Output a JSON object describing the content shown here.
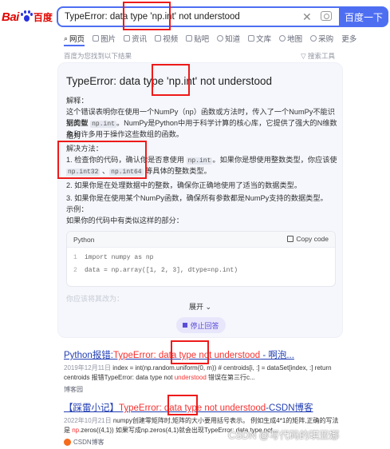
{
  "header": {
    "logo_text": "Bai",
    "logo_text2": "百度",
    "search_value": "TypeError: data type 'np.int' not understood",
    "clear_icon": "close-icon",
    "camera_icon": "camera-icon",
    "search_button": "百度一下"
  },
  "tabs": [
    {
      "label": "网页",
      "icon": "search-icon"
    },
    {
      "label": "图片",
      "icon": "image-icon"
    },
    {
      "label": "资讯",
      "icon": "news-icon"
    },
    {
      "label": "视频",
      "icon": "video-icon"
    },
    {
      "label": "贴吧",
      "icon": "tieba-icon"
    },
    {
      "label": "知道",
      "icon": "zhidao-icon"
    },
    {
      "label": "文库",
      "icon": "doc-icon"
    },
    {
      "label": "地图",
      "icon": "map-icon"
    },
    {
      "label": "采购",
      "icon": "cart-icon"
    },
    {
      "label": "更多",
      "icon": ""
    }
  ],
  "info_bar": {
    "left": "百度为您找到以下结果",
    "right": "搜索工具"
  },
  "ai_answer": {
    "title": "TypeError: data type 'np.int' not understood",
    "explain_head": "解释：",
    "explain_1a": "这个错误表明你在使用一个NumPy（np）函数或方法时，传入了一个NumPy不能识别的数",
    "explain_2a": "据类型 ",
    "explain_2_code": "np.int",
    "explain_2b": "。NumPy是Python中用于科学计算的核心库，它提供了强大的N维数组对",
    "explain_3": "象和许多用于操作这些数组的函数。",
    "solution_head": "解决方法：",
    "step1a": "1.  检查你的代码，确认你是否意使用 ",
    "step1_code": "np.int",
    "step1b": "。如果你是想使用整数类型，你应该使用",
    "step1c_code": "np.int32",
    "step1d": " 、",
    "step1e_code": "np.int64",
    "step1f": " 等具体的整数类型。",
    "step2": "2.  如果你是在处理数据中的整数，确保你正确地使用了适当的数据类型。",
    "step3": "3.  如果你是在使用某个NumPy函数，确保所有参数都是NumPy支持的数据类型。",
    "example_head": "示例：",
    "example_line": "如果你的代码中有类似这样的部分：",
    "code_lang": "Python",
    "copy_label": "Copy code",
    "code_line1": "import numpy as np",
    "code_line2": "data = np.array([1, 2, 3], dtype=np.int)",
    "fade_text": "你应该将其改为：",
    "expand_label": "展开",
    "stop_label": "停止回答"
  },
  "results": [
    {
      "title_a": "Python报错:",
      "title_b": "TypeError: data type not understood",
      "title_c": " - 啊泡...",
      "desc_date": "2019年12月11日",
      "desc_a": " index = int(np.random.uniform(0, m)) # centroids[i, :] = dataSet[index, :] return centroids 报错TypeError: data type not ",
      "desc_em": "understood",
      "desc_b": " 错误在第三行c...",
      "source": "博客园"
    },
    {
      "title_a": "【踩雷小记】",
      "title_b": "TypeError: data type not understood",
      "title_c": "-CSDN博客",
      "desc_date": "2022年10月21日",
      "desc_a": " numpy创建零矩阵时,矩阵的大小要用括号表示。 例如生成4*1的矩阵,正确的写法是 ",
      "desc_em": "np",
      "desc_b": ".zeros((4,1)) 如果写成np.zeros(4,1)就会出现TypeError: data type not...",
      "source": "CSDN博客"
    }
  ],
  "watermark": "CSDN @写代码的琪亚娜",
  "colors": {
    "brand_blue": "#4e6ef2",
    "link_blue": "#2440b3",
    "highlight_red": "#f73131",
    "annotation_red": "#ee1a1a"
  }
}
